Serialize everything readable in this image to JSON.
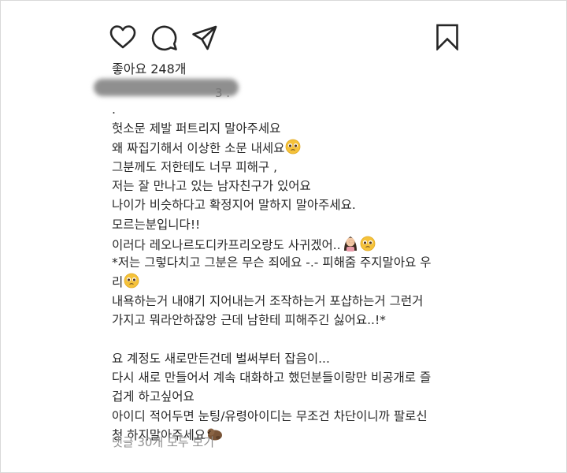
{
  "post": {
    "actions": {
      "like_icon": "heart-outline-icon",
      "comment_icon": "comment-bubble-icon",
      "share_icon": "paper-plane-icon",
      "bookmark_icon": "bookmark-outline-icon"
    },
    "likes_text": "좋아요 248개",
    "username_tail": "3 .",
    "caption_lines": [
      ".",
      "헛소문 제발 퍼트리지 말아주세요",
      "왜 짜집기해서 이상한 소문 내세요",
      "그분께도 저한테도 너무 피해구 ,",
      "저는 잘 만나고 있는 남자친구가 있어요",
      "나이가 비슷하다고 확정지어 말하지 말아주세요.",
      "모르는분입니다!!",
      "이러다 레오나르도디카프리오랑도 사귀겠어..",
      "*저는 그렇다치고 그분은 무슨 죄에요 -.- 피해줌 주지말아요 우",
      "리",
      "내욕하는거 내얘기 지어내는거 조작하는거 포샵하는거 그런거",
      "가지고 뭐라안하잖앙 근데 남한테 피해주긴 싫어요..!*",
      "",
      "요 계정도 새로만든건데 벌써부터 잡음이...",
      "다시 새로 만들어서 계속 대화하고 했던분들이랑만 비공개로 즐",
      "겁게 하고싶어요",
      "아이디 적어두면 눈팅/유령아이디는 무조건 차단이니까 팔로신",
      "청 하지말아주세요"
    ],
    "view_comments": "댓글 30개 모두 보기",
    "colors": {
      "text": "#262626",
      "muted": "#8e8e8e",
      "redaction": "#8f8f8f"
    }
  }
}
